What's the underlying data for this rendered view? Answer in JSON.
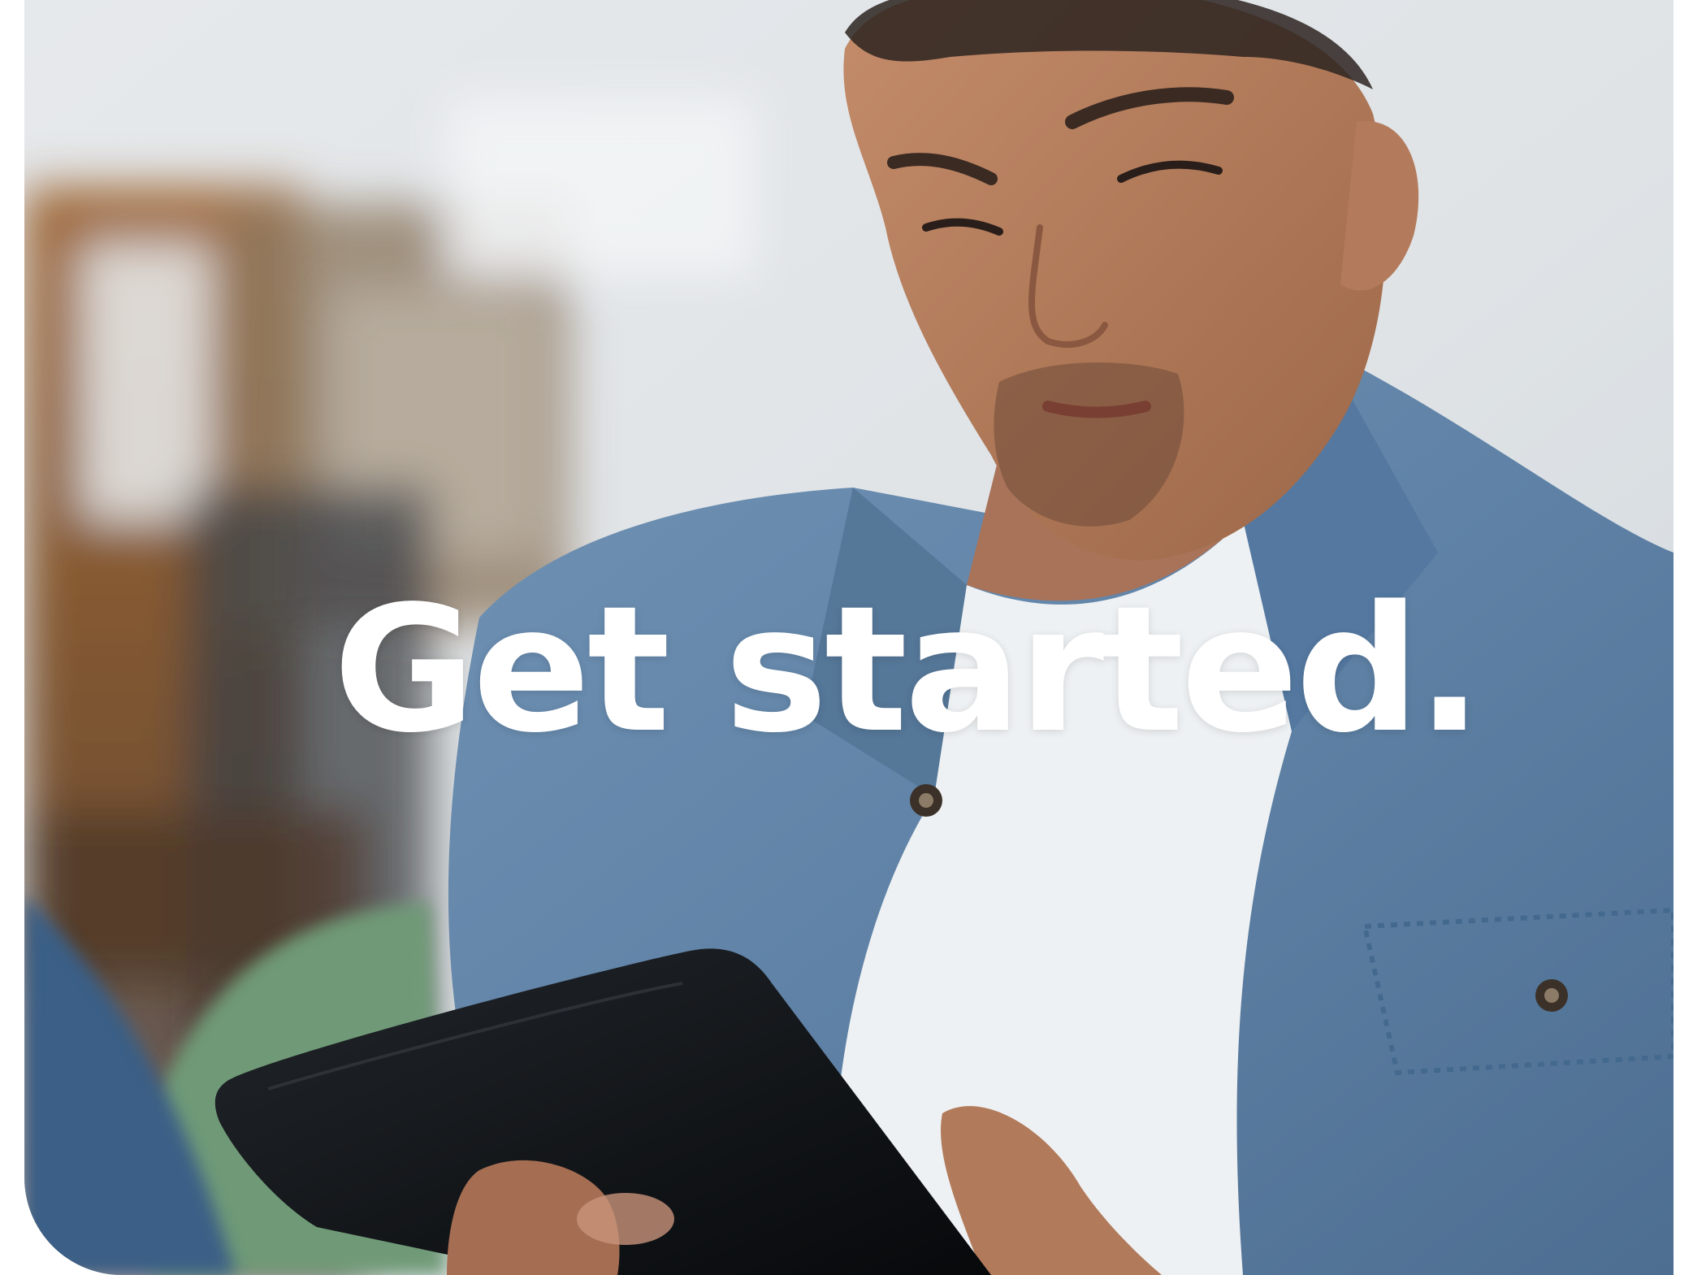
{
  "hero": {
    "headline": "Get started.",
    "photo_subject": "man-reading-tablet",
    "colors": {
      "headline": "#ffffff",
      "shirt": "#5f82a6",
      "background": "#d9dee2",
      "tablet": "#0f1216"
    }
  }
}
